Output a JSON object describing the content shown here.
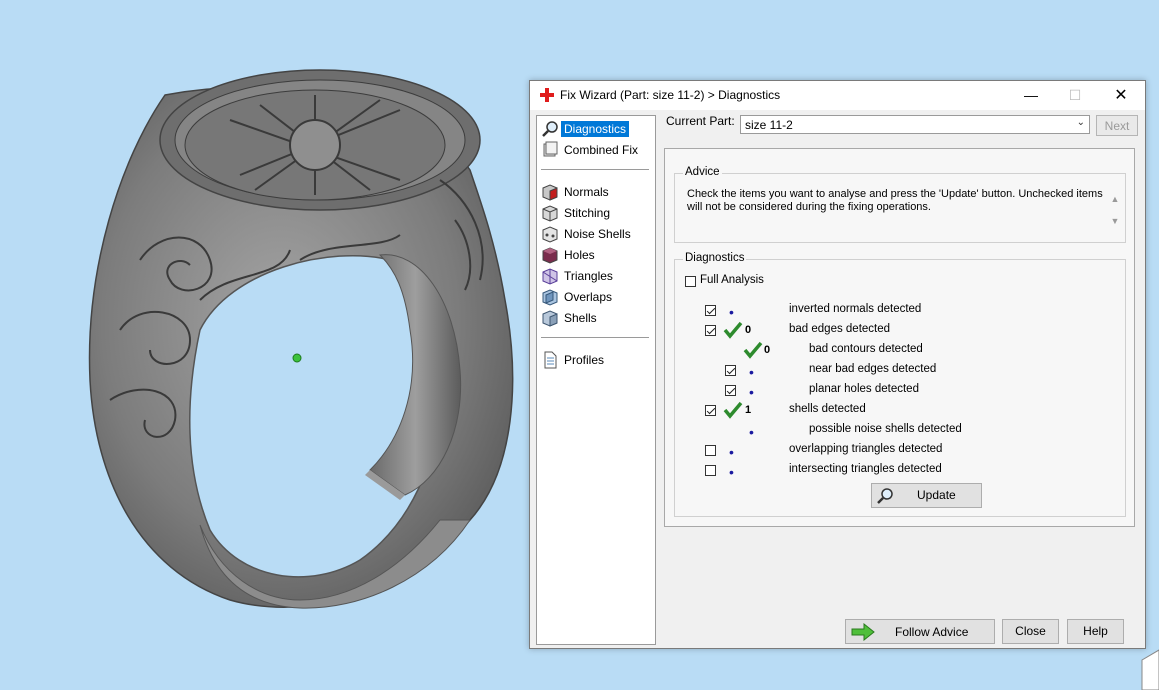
{
  "window": {
    "title": "Fix Wizard (Part: size 11-2) > Diagnostics",
    "minimize": "—",
    "maximize": "☐",
    "close": "✕"
  },
  "nav": {
    "items": [
      {
        "label": "Diagnostics",
        "icon": "magnifier-icon",
        "selected": true
      },
      {
        "label": "Combined Fix",
        "icon": "stack-icon"
      },
      {
        "label": "Normals",
        "icon": "cube-red-face-icon"
      },
      {
        "label": "Stitching",
        "icon": "stitch-cube-icon"
      },
      {
        "label": "Noise Shells",
        "icon": "noise-cube-icon"
      },
      {
        "label": "Holes",
        "icon": "hole-cube-icon"
      },
      {
        "label": "Triangles",
        "icon": "triangle-cube-icon"
      },
      {
        "label": "Overlaps",
        "icon": "overlap-cube-icon"
      },
      {
        "label": "Shells",
        "icon": "shell-cube-icon"
      },
      {
        "label": "Profiles",
        "icon": "document-icon"
      }
    ]
  },
  "part": {
    "label": "Current Part:",
    "value": "size 11-2",
    "next": "Next"
  },
  "advice": {
    "title": "Advice",
    "text": "Check the items you want to analyse and press the 'Update' button. Unchecked items will not be considered during the fixing operations."
  },
  "diagnostics": {
    "title": "Diagnostics",
    "full_analysis": "Full Analysis",
    "rows": [
      {
        "label": "inverted normals detected",
        "checked": true,
        "value": "•"
      },
      {
        "label": "bad edges detected",
        "checked": true,
        "value": "0",
        "ok": true
      },
      {
        "label": "bad contours detected",
        "value": "0",
        "ok": true,
        "sub": true
      },
      {
        "label": "near bad edges detected",
        "checked": true,
        "value": "•",
        "sub": true
      },
      {
        "label": "planar holes detected",
        "checked": true,
        "value": "•",
        "sub": true
      },
      {
        "label": "shells detected",
        "checked": true,
        "value": "1",
        "ok": true
      },
      {
        "label": "possible noise shells detected",
        "value": "•",
        "sub": true
      },
      {
        "label": "overlapping triangles detected",
        "checked": false,
        "value": "•"
      },
      {
        "label": "intersecting triangles detected",
        "checked": false,
        "value": "•"
      }
    ],
    "update": "Update"
  },
  "footer": {
    "follow_advice": "Follow Advice",
    "close": "Close",
    "help": "Help"
  },
  "colors": {
    "background": "#b9dcf5",
    "selection": "#0078d7",
    "ok_tick": "#2e8b2e",
    "ring_metal": "#8a8a8a"
  }
}
